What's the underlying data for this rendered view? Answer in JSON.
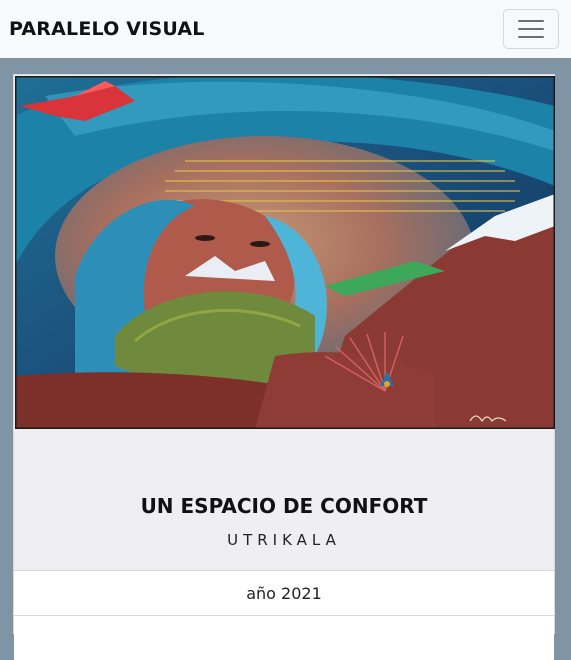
{
  "navbar": {
    "brand": "PARALELO VISUAL",
    "toggle_icon": "hamburger-icon"
  },
  "artwork": {
    "title": "UN ESPACIO DE CONFORT",
    "artist": "UTRIKALA",
    "year": "año 2021"
  },
  "colors": {
    "navbar_bg": "#f8f9fa",
    "page_bg": "#7f95a6",
    "card_bg": "#efeff2"
  }
}
